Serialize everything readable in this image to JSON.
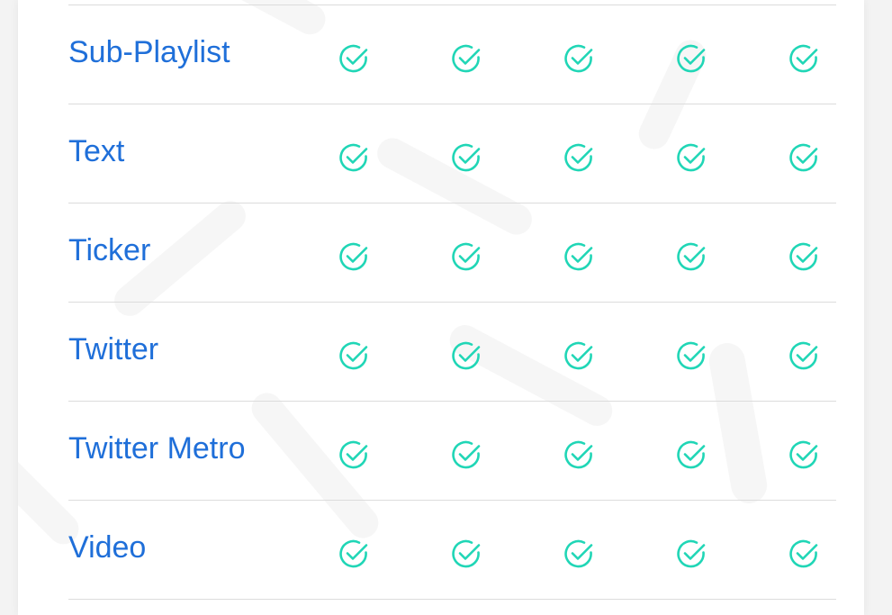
{
  "accent_color": "#20d6b6",
  "label_color": "#1f6fd9",
  "rows": [
    {
      "label": "Sub-Playlist",
      "checks": [
        true,
        true,
        true,
        true,
        true
      ]
    },
    {
      "label": "Text",
      "checks": [
        true,
        true,
        true,
        true,
        true
      ]
    },
    {
      "label": "Ticker",
      "checks": [
        true,
        true,
        true,
        true,
        true
      ]
    },
    {
      "label": "Twitter",
      "checks": [
        true,
        true,
        true,
        true,
        true
      ]
    },
    {
      "label": "Twitter Metro",
      "checks": [
        true,
        true,
        true,
        true,
        true
      ]
    },
    {
      "label": "Video",
      "checks": [
        true,
        true,
        true,
        true,
        true
      ]
    }
  ],
  "icons": {
    "check": "check-circle-icon"
  }
}
